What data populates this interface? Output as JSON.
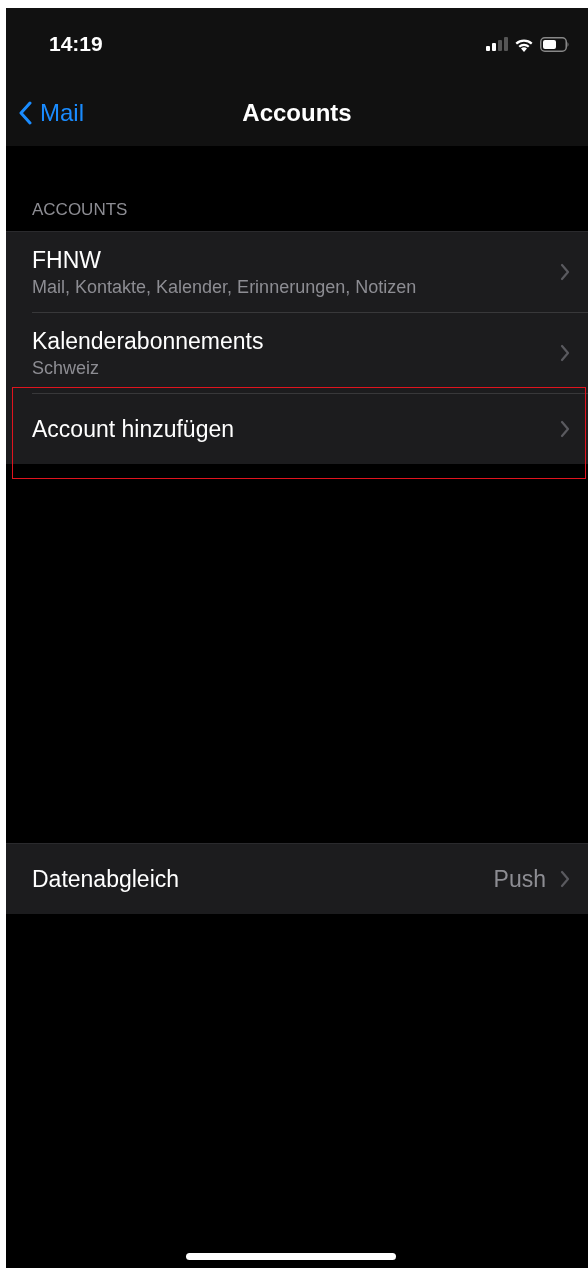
{
  "status_bar": {
    "time": "14:19"
  },
  "nav_bar": {
    "back_label": "Mail",
    "title": "Accounts"
  },
  "accounts_section": {
    "header": "ACCOUNTS",
    "rows": [
      {
        "title": "FHNW",
        "subtitle": "Mail, Kontakte, Kalender, Erinnerungen, Notizen",
        "highlighted": false
      },
      {
        "title": "Kalenderabonnements",
        "subtitle": "Schweiz",
        "highlighted": false
      },
      {
        "title": "Account hinzufügen",
        "highlighted": true
      }
    ]
  },
  "sync_row": {
    "title": "Datenabgleich",
    "value": "Push"
  }
}
